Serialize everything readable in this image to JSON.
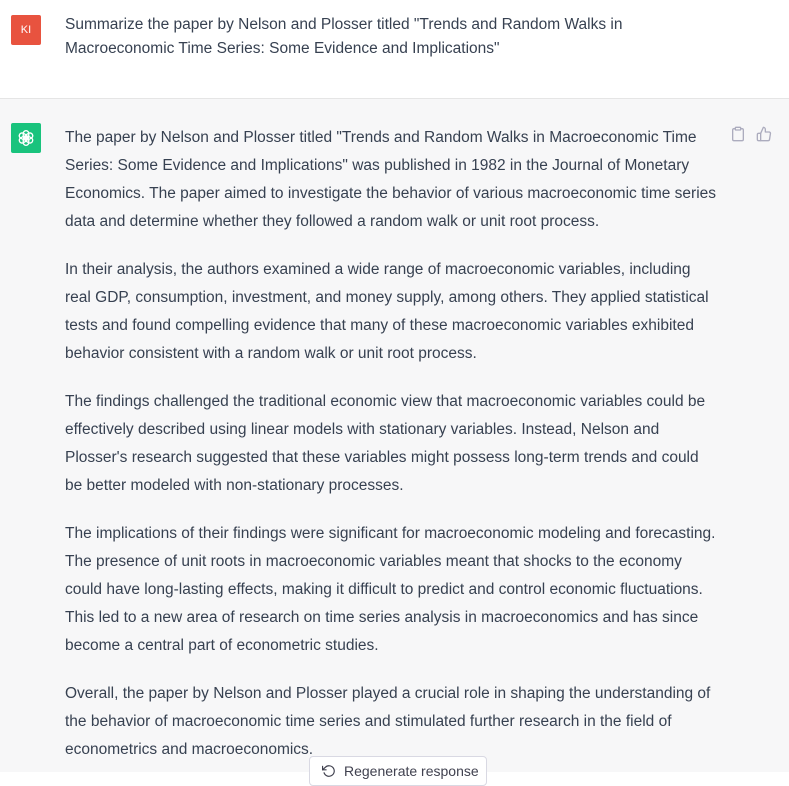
{
  "user": {
    "avatar_initials": "KI",
    "avatar_color": "#e8533f",
    "message": "Summarize the paper by Nelson and Plosser titled \"Trends and Random Walks in Macroeconomic Time Series: Some Evidence and Implications\""
  },
  "assistant": {
    "avatar_icon": "openai-logo-icon",
    "avatar_color": "#19c37d",
    "paragraphs": [
      "The paper by Nelson and Plosser titled \"Trends and Random Walks in Macroeconomic Time Series: Some Evidence and Implications\" was published in 1982 in the Journal of Monetary Economics. The paper aimed to investigate the behavior of various macroeconomic time series data and determine whether they followed a random walk or unit root process.",
      "In their analysis, the authors examined a wide range of macroeconomic variables, including real GDP, consumption, investment, and money supply, among others. They applied statistical tests and found compelling evidence that many of these macroeconomic variables exhibited behavior consistent with a random walk or unit root process.",
      "The findings challenged the traditional economic view that macroeconomic variables could be effectively described using linear models with stationary variables. Instead, Nelson and Plosser's research suggested that these variables might possess long-term trends and could be better modeled with non-stationary processes.",
      "The implications of their findings were significant for macroeconomic modeling and forecasting. The presence of unit roots in macroeconomic variables meant that shocks to the economy could have long-lasting effects, making it difficult to predict and control economic fluctuations. This led to a new area of research on time series analysis in macroeconomics and has since become a central part of econometric studies.",
      "Overall, the paper by Nelson and Plosser played a crucial role in shaping the understanding of the behavior of macroeconomic time series and stimulated further research in the field of econometrics and macroeconomics."
    ]
  },
  "actions": {
    "copy_icon": "clipboard-icon",
    "thumbs_up_icon": "thumbs-up-icon"
  },
  "regenerate": {
    "label": "Regenerate response",
    "icon": "refresh-icon"
  }
}
